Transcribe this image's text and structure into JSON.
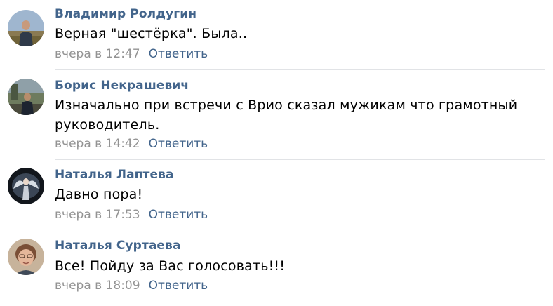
{
  "comments": [
    {
      "author": "Владимир Ролдугин",
      "text": "Верная \"шестёрка\". Была..",
      "date": "вчера в 12:47",
      "reply_label": "Ответить",
      "avatar_icon": "user-photo-field"
    },
    {
      "author": "Борис Некрашевич",
      "text": "Изначально при встречи с Врио сказал мужикам что грамотный руководитель.",
      "date": "вчера в 14:42",
      "reply_label": "Ответить",
      "avatar_icon": "user-photo-outdoor"
    },
    {
      "author": "Наталья Лаптева",
      "text": "Давно пора!",
      "date": "вчера в 17:53",
      "reply_label": "Ответить",
      "avatar_icon": "user-photo-angel"
    },
    {
      "author": "Наталья Суртаева",
      "text": "Все! Пойду за Вас голосовать!!!",
      "date": "вчера в 18:09",
      "reply_label": "Ответить",
      "avatar_icon": "user-photo-portrait"
    }
  ],
  "colors": {
    "author_link": "#42648b",
    "meta_gray": "#939393",
    "separator": "#e1e3e6"
  }
}
